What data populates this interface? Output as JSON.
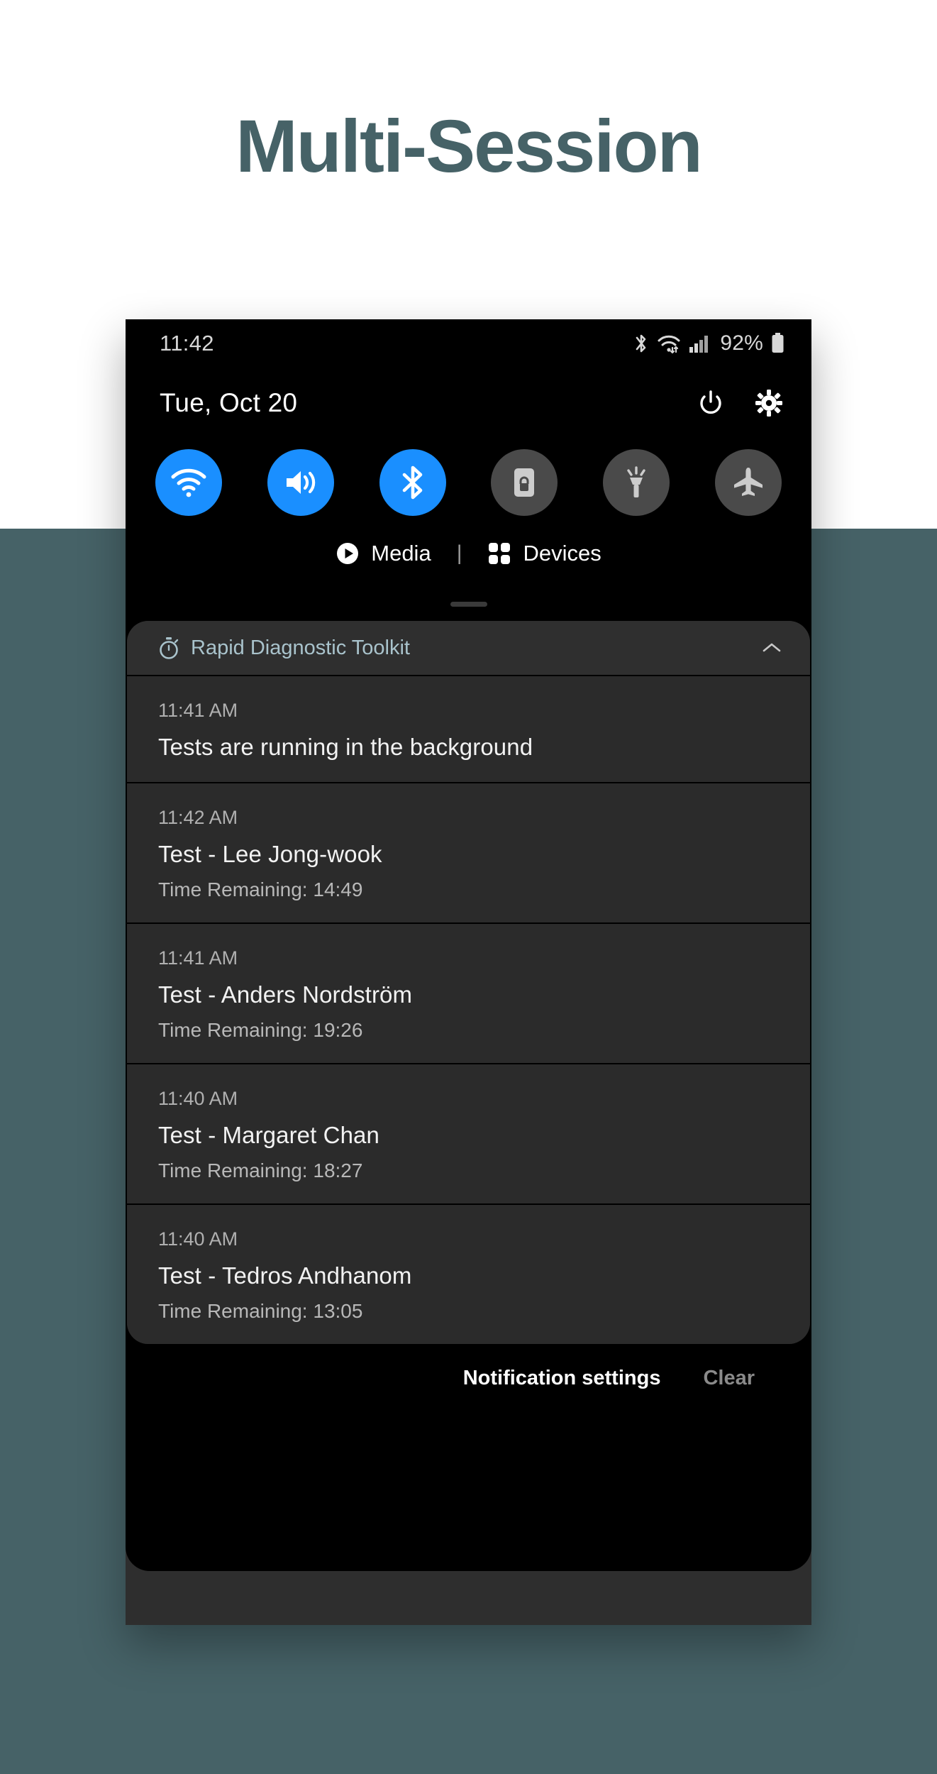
{
  "hero": {
    "title": "Multi-Session"
  },
  "colors": {
    "background_teal": "#466267",
    "title_teal": "#466267",
    "toggle_on_blue": "#1a8fff",
    "toggle_off_gray": "#4a4a4a",
    "app_name_accent": "#a9c3cc",
    "shade_black": "#000000",
    "notification_card": "#2b2b2b"
  },
  "status_bar": {
    "clock": "11:42",
    "battery_percent": "92%",
    "icons": [
      "bluetooth-icon",
      "wifi-icon",
      "cellular-signal-icon",
      "battery-icon"
    ]
  },
  "quick_panel": {
    "date": "Tue, Oct 20",
    "power_icon": "power-icon",
    "settings_icon": "gear-icon",
    "toggles": [
      {
        "name": "wifi",
        "icon": "wifi-icon",
        "state": "on"
      },
      {
        "name": "sound",
        "icon": "volume-icon",
        "state": "on"
      },
      {
        "name": "bluetooth",
        "icon": "bluetooth-icon",
        "state": "on"
      },
      {
        "name": "screen-lock",
        "icon": "lock-icon",
        "state": "off"
      },
      {
        "name": "flashlight",
        "icon": "flashlight-icon",
        "state": "off"
      },
      {
        "name": "airplane",
        "icon": "airplane-icon",
        "state": "off"
      }
    ],
    "media_label": "Media",
    "separator": "|",
    "devices_label": "Devices"
  },
  "notifications": {
    "app_name": "Rapid Diagnostic Toolkit",
    "app_icon": "stopwatch-icon",
    "collapse_icon": "chevron-up-icon",
    "items": [
      {
        "time": "11:41 AM",
        "title": "Tests are running in the background",
        "subtitle": ""
      },
      {
        "time": "11:42 AM",
        "title": "Test - Lee Jong-wook",
        "subtitle": "Time Remaining: 14:49"
      },
      {
        "time": "11:41 AM",
        "title": "Test - Anders Nordström",
        "subtitle": "Time Remaining: 19:26"
      },
      {
        "time": "11:40 AM",
        "title": "Test - Margaret Chan",
        "subtitle": "Time Remaining: 18:27"
      },
      {
        "time": "11:40 AM",
        "title": "Test - Tedros Andhanom",
        "subtitle": "Time Remaining: 13:05"
      }
    ],
    "footer": {
      "settings_label": "Notification settings",
      "clear_label": "Clear"
    }
  }
}
